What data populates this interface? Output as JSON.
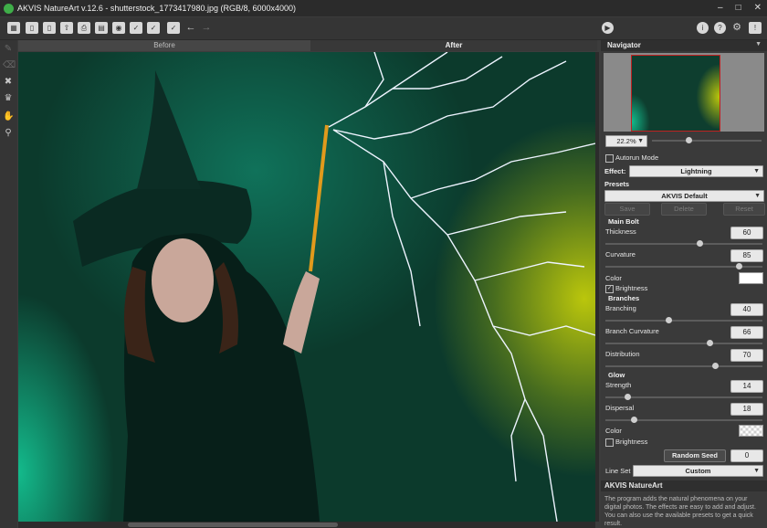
{
  "window": {
    "title": "AKVIS NatureArt v.12.6 - shutterstock_1773417980.jpg (RGB/8, 6000x4000)"
  },
  "tabs": {
    "before": "Before",
    "after": "After"
  },
  "navigator": {
    "title": "Navigator",
    "zoom": "22.2%",
    "zoom_slider": 0.33
  },
  "settings": {
    "autorun_label": "Autorun Mode",
    "autorun_checked": false,
    "effect_label": "Effect:",
    "effect_value": "Lightning",
    "presets_label": "Presets",
    "preset_value": "AKVIS Default",
    "save_label": "Save",
    "delete_label": "Delete",
    "reset_label": "Reset",
    "main_bolt": {
      "title": "Main Bolt",
      "thickness_label": "Thickness",
      "thickness": "60",
      "curvature_label": "Curvature",
      "curvature": "85",
      "color_label": "Color",
      "color": "#ffffff",
      "brightness_label": "Brightness",
      "brightness_checked": true
    },
    "branches": {
      "title": "Branches",
      "branching_label": "Branching",
      "branching": "40",
      "branch_curvature_label": "Branch Curvature",
      "branch_curvature": "66",
      "distribution_label": "Distribution",
      "distribution": "70"
    },
    "glow": {
      "title": "Glow",
      "strength_label": "Strength",
      "strength": "14",
      "dispersal_label": "Dispersal",
      "dispersal": "18",
      "color_label": "Color",
      "brightness_label": "Brightness",
      "brightness_checked": false
    },
    "random_seed_label": "Random Seed",
    "random_seed": "0",
    "line_set_label": "Line Set",
    "line_set_value": "Custom"
  },
  "info": {
    "title": "AKVIS NatureArt",
    "text": "The program adds the natural phenomena on your digital photos. The effects are easy to add and adjust. You can also use the available presets to get a quick result."
  },
  "colors": {
    "accent": "#3fae49",
    "lightning": "#eef4ff",
    "glow_yellow": "#c4ce0a",
    "background_green": "#0c3a2c"
  }
}
